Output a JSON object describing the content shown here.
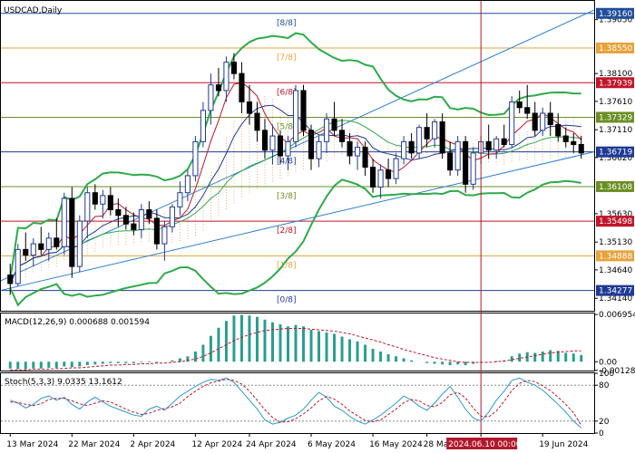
{
  "chart_data": [
    {
      "type": "candlestick",
      "title": "USDCAD,Daily",
      "price_range": [
        1.3392,
        1.3938
      ],
      "price_ticks": [
        1.3905,
        1.381,
        1.3761,
        1.3711,
        1.3662,
        1.3563,
        1.3513,
        1.3464,
        1.3414
      ],
      "marked_prices": [
        {
          "value": "1.39160",
          "color": "#1f4e9a"
        },
        {
          "value": "1.38550",
          "color": "#e6a23c"
        },
        {
          "value": "1.37939",
          "color": "#c0152a"
        },
        {
          "value": "1.37329",
          "color": "#6b8e23"
        },
        {
          "value": "1.36719",
          "color": "#1f3a93"
        },
        {
          "value": "1.36108",
          "color": "#6b8e23"
        },
        {
          "value": "1.35498",
          "color": "#c0152a"
        },
        {
          "value": "1.34888",
          "color": "#e6a23c"
        },
        {
          "value": "1.34277",
          "color": "#1f3a93"
        }
      ],
      "murrey_levels": [
        {
          "label": "[8/8]",
          "price": 1.3916,
          "color": "#1f4e9a"
        },
        {
          "label": "[7/8]",
          "price": 1.3855,
          "color": "#e6a23c"
        },
        {
          "label": "[6/8]",
          "price": 1.37939,
          "color": "#c0152a"
        },
        {
          "label": "[5/8]",
          "price": 1.37329,
          "color": "#6b8e23"
        },
        {
          "label": "[4/8]",
          "price": 1.36719,
          "color": "#1f3a93"
        },
        {
          "label": "[3/8]",
          "price": 1.36108,
          "color": "#6b8e23"
        },
        {
          "label": "[2/8]",
          "price": 1.35498,
          "color": "#c0152a"
        },
        {
          "label": "[1/8]",
          "price": 1.34888,
          "color": "#e6a23c"
        },
        {
          "label": "[0/8]",
          "price": 1.34277,
          "color": "#1f3a93"
        }
      ],
      "x_labels": [
        "13 Mar 2024",
        "22 Mar 2024",
        "2 Apr 2024",
        "12 Apr 2024",
        "24 Apr 2024",
        "6 May 2024",
        "16 May 2024",
        "28 May 2024",
        "2024.06.10 00:00",
        "19 Jun 2024"
      ],
      "candles": [
        {
          "o": 1.3455,
          "h": 1.3475,
          "l": 1.342,
          "c": 1.344
        },
        {
          "o": 1.344,
          "h": 1.351,
          "l": 1.3435,
          "c": 1.35
        },
        {
          "o": 1.35,
          "h": 1.353,
          "l": 1.348,
          "c": 1.349
        },
        {
          "o": 1.349,
          "h": 1.352,
          "l": 1.347,
          "c": 1.351
        },
        {
          "o": 1.351,
          "h": 1.354,
          "l": 1.349,
          "c": 1.35
        },
        {
          "o": 1.35,
          "h": 1.353,
          "l": 1.348,
          "c": 1.352
        },
        {
          "o": 1.352,
          "h": 1.3555,
          "l": 1.35,
          "c": 1.3505
        },
        {
          "o": 1.3505,
          "h": 1.36,
          "l": 1.349,
          "c": 1.359
        },
        {
          "o": 1.359,
          "h": 1.361,
          "l": 1.345,
          "c": 1.347
        },
        {
          "o": 1.347,
          "h": 1.356,
          "l": 1.346,
          "c": 1.355
        },
        {
          "o": 1.355,
          "h": 1.361,
          "l": 1.352,
          "c": 1.36
        },
        {
          "o": 1.36,
          "h": 1.3615,
          "l": 1.357,
          "c": 1.358
        },
        {
          "o": 1.358,
          "h": 1.3605,
          "l": 1.3555,
          "c": 1.3595
        },
        {
          "o": 1.3595,
          "h": 1.361,
          "l": 1.356,
          "c": 1.357
        },
        {
          "o": 1.357,
          "h": 1.359,
          "l": 1.354,
          "c": 1.356
        },
        {
          "o": 1.356,
          "h": 1.3575,
          "l": 1.3535,
          "c": 1.3545
        },
        {
          "o": 1.3545,
          "h": 1.3565,
          "l": 1.3525,
          "c": 1.3535
        },
        {
          "o": 1.3535,
          "h": 1.358,
          "l": 1.352,
          "c": 1.357
        },
        {
          "o": 1.357,
          "h": 1.3585,
          "l": 1.3545,
          "c": 1.3555
        },
        {
          "o": 1.3555,
          "h": 1.357,
          "l": 1.35,
          "c": 1.351
        },
        {
          "o": 1.351,
          "h": 1.355,
          "l": 1.348,
          "c": 1.354
        },
        {
          "o": 1.354,
          "h": 1.358,
          "l": 1.353,
          "c": 1.3575
        },
        {
          "o": 1.3575,
          "h": 1.362,
          "l": 1.356,
          "c": 1.36
        },
        {
          "o": 1.36,
          "h": 1.364,
          "l": 1.3585,
          "c": 1.363
        },
        {
          "o": 1.363,
          "h": 1.37,
          "l": 1.362,
          "c": 1.369
        },
        {
          "o": 1.369,
          "h": 1.376,
          "l": 1.368,
          "c": 1.3745
        },
        {
          "o": 1.3745,
          "h": 1.381,
          "l": 1.372,
          "c": 1.379
        },
        {
          "o": 1.379,
          "h": 1.382,
          "l": 1.377,
          "c": 1.378
        },
        {
          "o": 1.378,
          "h": 1.384,
          "l": 1.376,
          "c": 1.383
        },
        {
          "o": 1.383,
          "h": 1.3846,
          "l": 1.38,
          "c": 1.381
        },
        {
          "o": 1.381,
          "h": 1.383,
          "l": 1.374,
          "c": 1.376
        },
        {
          "o": 1.376,
          "h": 1.379,
          "l": 1.372,
          "c": 1.374
        },
        {
          "o": 1.374,
          "h": 1.376,
          "l": 1.369,
          "c": 1.371
        },
        {
          "o": 1.371,
          "h": 1.373,
          "l": 1.366,
          "c": 1.3675
        },
        {
          "o": 1.3675,
          "h": 1.372,
          "l": 1.365,
          "c": 1.37
        },
        {
          "o": 1.37,
          "h": 1.371,
          "l": 1.365,
          "c": 1.3665
        },
        {
          "o": 1.3665,
          "h": 1.37,
          "l": 1.364,
          "c": 1.369
        },
        {
          "o": 1.369,
          "h": 1.379,
          "l": 1.368,
          "c": 1.378
        },
        {
          "o": 1.378,
          "h": 1.379,
          "l": 1.37,
          "c": 1.371
        },
        {
          "o": 1.371,
          "h": 1.372,
          "l": 1.364,
          "c": 1.366
        },
        {
          "o": 1.366,
          "h": 1.37,
          "l": 1.3645,
          "c": 1.369
        },
        {
          "o": 1.369,
          "h": 1.374,
          "l": 1.367,
          "c": 1.373
        },
        {
          "o": 1.373,
          "h": 1.376,
          "l": 1.37,
          "c": 1.371
        },
        {
          "o": 1.371,
          "h": 1.373,
          "l": 1.368,
          "c": 1.369
        },
        {
          "o": 1.369,
          "h": 1.3705,
          "l": 1.365,
          "c": 1.3665
        },
        {
          "o": 1.3665,
          "h": 1.369,
          "l": 1.364,
          "c": 1.368
        },
        {
          "o": 1.368,
          "h": 1.369,
          "l": 1.363,
          "c": 1.3645
        },
        {
          "o": 1.3645,
          "h": 1.366,
          "l": 1.36,
          "c": 1.361
        },
        {
          "o": 1.361,
          "h": 1.365,
          "l": 1.359,
          "c": 1.364
        },
        {
          "o": 1.364,
          "h": 1.366,
          "l": 1.361,
          "c": 1.3625
        },
        {
          "o": 1.3625,
          "h": 1.367,
          "l": 1.3615,
          "c": 1.366
        },
        {
          "o": 1.366,
          "h": 1.37,
          "l": 1.365,
          "c": 1.369
        },
        {
          "o": 1.369,
          "h": 1.3705,
          "l": 1.366,
          "c": 1.367
        },
        {
          "o": 1.367,
          "h": 1.372,
          "l": 1.366,
          "c": 1.3715
        },
        {
          "o": 1.3715,
          "h": 1.374,
          "l": 1.368,
          "c": 1.3695
        },
        {
          "o": 1.3695,
          "h": 1.373,
          "l": 1.368,
          "c": 1.3725
        },
        {
          "o": 1.3725,
          "h": 1.374,
          "l": 1.366,
          "c": 1.367
        },
        {
          "o": 1.367,
          "h": 1.369,
          "l": 1.363,
          "c": 1.364
        },
        {
          "o": 1.364,
          "h": 1.37,
          "l": 1.363,
          "c": 1.369
        },
        {
          "o": 1.369,
          "h": 1.37,
          "l": 1.36,
          "c": 1.3615
        },
        {
          "o": 1.3615,
          "h": 1.368,
          "l": 1.3605,
          "c": 1.367
        },
        {
          "o": 1.367,
          "h": 1.37,
          "l": 1.365,
          "c": 1.369
        },
        {
          "o": 1.369,
          "h": 1.372,
          "l": 1.366,
          "c": 1.3675
        },
        {
          "o": 1.3675,
          "h": 1.37,
          "l": 1.366,
          "c": 1.3695
        },
        {
          "o": 1.3695,
          "h": 1.372,
          "l": 1.368,
          "c": 1.3685
        },
        {
          "o": 1.3685,
          "h": 1.377,
          "l": 1.368,
          "c": 1.376
        },
        {
          "o": 1.376,
          "h": 1.378,
          "l": 1.374,
          "c": 1.375
        },
        {
          "o": 1.375,
          "h": 1.379,
          "l": 1.373,
          "c": 1.374
        },
        {
          "o": 1.374,
          "h": 1.376,
          "l": 1.37,
          "c": 1.371
        },
        {
          "o": 1.371,
          "h": 1.375,
          "l": 1.37,
          "c": 1.374
        },
        {
          "o": 1.374,
          "h": 1.376,
          "l": 1.37,
          "c": 1.372
        },
        {
          "o": 1.372,
          "h": 1.374,
          "l": 1.369,
          "c": 1.37
        },
        {
          "o": 1.37,
          "h": 1.3715,
          "l": 1.368,
          "c": 1.369
        },
        {
          "o": 1.369,
          "h": 1.3705,
          "l": 1.367,
          "c": 1.3685
        },
        {
          "o": 1.3685,
          "h": 1.37,
          "l": 1.366,
          "c": 1.367
        }
      ],
      "subwindows": [
        {
          "type": "histogram",
          "label": "MACD(12,26,9) 0.000688 0.001594",
          "ticks": [
            "0.006954",
            "0.00",
            "-0.001283"
          ],
          "value_range": [
            -0.0013,
            0.0071
          ],
          "histogram": [
            -0.001,
            -0.0011,
            -0.0011,
            -0.001,
            -0.001,
            -0.0009,
            -0.0009,
            -0.0007,
            -0.0008,
            -0.0007,
            -0.0005,
            -0.0004,
            -0.0003,
            -0.0002,
            -0.0002,
            -0.0002,
            -0.0002,
            -0.0001,
            -0.0001,
            -0.0001,
            0.0,
            0.0002,
            0.0005,
            0.0008,
            0.0015,
            0.0025,
            0.0038,
            0.005,
            0.006,
            0.0068,
            0.0069,
            0.0068,
            0.0066,
            0.0062,
            0.0058,
            0.0055,
            0.0052,
            0.0054,
            0.0052,
            0.0047,
            0.0045,
            0.0043,
            0.0041,
            0.0037,
            0.0033,
            0.003,
            0.0025,
            0.0019,
            0.0015,
            0.0011,
            0.0008,
            0.0005,
            0.0002,
            0.0,
            -0.0002,
            -0.0003,
            -0.0004,
            -0.0005,
            -0.0004,
            -0.0005,
            -0.0003,
            -0.0001,
            0.0,
            0.0001,
            0.0002,
            0.0008,
            0.0012,
            0.0014,
            0.0013,
            0.0015,
            0.0017,
            0.0016,
            0.0013,
            0.0012,
            0.001
          ],
          "signal": [
            -0.0012,
            -0.0012,
            -0.0012,
            -0.0011,
            -0.0011,
            -0.0011,
            -0.001,
            -0.001,
            -0.0009,
            -0.0009,
            -0.0008,
            -0.0007,
            -0.0006,
            -0.0005,
            -0.0005,
            -0.0004,
            -0.0004,
            -0.0003,
            -0.0003,
            -0.0002,
            -0.0002,
            -0.0001,
            0.0,
            0.0002,
            0.0004,
            0.0008,
            0.0013,
            0.0019,
            0.0025,
            0.0031,
            0.0036,
            0.004,
            0.0043,
            0.0046,
            0.0047,
            0.0048,
            0.0049,
            0.0049,
            0.0049,
            0.0048,
            0.0047,
            0.0046,
            0.0045,
            0.0043,
            0.0041,
            0.0038,
            0.0035,
            0.0032,
            0.0029,
            0.0025,
            0.0022,
            0.0018,
            0.0015,
            0.0012,
            0.0009,
            0.0006,
            0.0004,
            0.0002,
            0.0,
            -0.0001,
            -0.0001,
            -0.0001,
            -0.0001,
            0.0,
            0.0001,
            0.0003,
            0.0005,
            0.0007,
            0.0009,
            0.0011,
            0.0013,
            0.0014,
            0.0015,
            0.0016,
            0.0016
          ]
        },
        {
          "type": "line",
          "label": "Stoch(5,3,3) 9.0335 13.1612",
          "ticks": [
            "100",
            "80",
            "20",
            "0"
          ],
          "value_range": [
            0,
            100
          ],
          "levels": [
            80,
            20
          ],
          "main": [
            55,
            50,
            42,
            48,
            58,
            62,
            55,
            60,
            48,
            40,
            52,
            60,
            52,
            45,
            40,
            35,
            30,
            28,
            40,
            45,
            38,
            50,
            62,
            70,
            78,
            85,
            90,
            88,
            92,
            85,
            70,
            55,
            40,
            22,
            15,
            18,
            25,
            30,
            40,
            55,
            68,
            60,
            45,
            38,
            28,
            20,
            15,
            22,
            30,
            40,
            50,
            62,
            55,
            45,
            38,
            50,
            65,
            78,
            60,
            40,
            25,
            20,
            35,
            55,
            70,
            88,
            92,
            85,
            80,
            72,
            60,
            48,
            35,
            20,
            9
          ],
          "signal": [
            52,
            51,
            48,
            46,
            49,
            56,
            58,
            58,
            54,
            49,
            46,
            50,
            54,
            52,
            46,
            40,
            35,
            31,
            33,
            38,
            41,
            44,
            50,
            61,
            70,
            78,
            84,
            87,
            90,
            88,
            82,
            70,
            55,
            39,
            26,
            18,
            19,
            24,
            32,
            42,
            54,
            61,
            57,
            48,
            37,
            29,
            21,
            19,
            22,
            31,
            40,
            51,
            56,
            54,
            46,
            44,
            51,
            64,
            68,
            59,
            42,
            28,
            27,
            37,
            53,
            71,
            83,
            88,
            86,
            79,
            71,
            60,
            48,
            34,
            13
          ]
        }
      ]
    }
  ],
  "colors": {
    "bull": "#1f3a93",
    "bear": "#000000",
    "bollinger": "#2eaa4a",
    "ma_fast": "#c0152a",
    "ma_slow": "#1f3a93",
    "stoch_main": "#2a9ad0",
    "stoch_signal": "#c0152a",
    "macd_hist": "#2a9d8f",
    "macd_signal": "#c0152a",
    "channel": "#2a7fd4",
    "cloud": "#e29a56",
    "current_time": "#b2182b"
  }
}
